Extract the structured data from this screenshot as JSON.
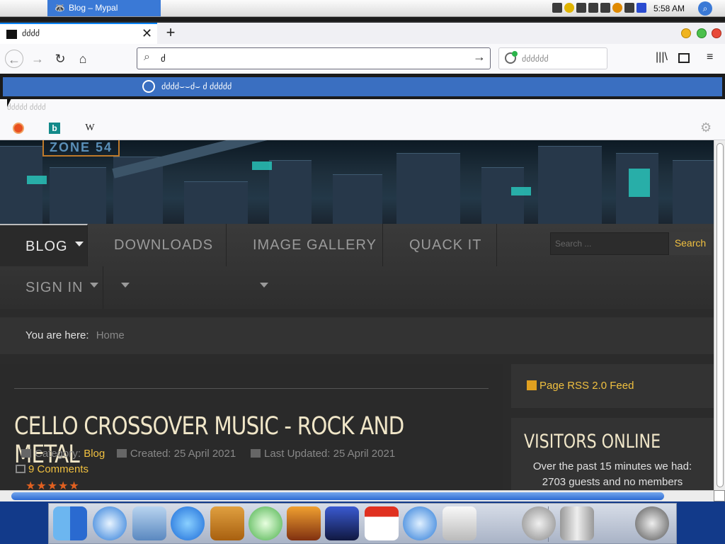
{
  "os": {
    "active_window_title": "Blog – Mypal",
    "clock": "5:58 AM"
  },
  "browser": {
    "tab_title": "ძძძძ",
    "url_value": "ძ",
    "search_placeholder": "ძძძძძძ",
    "notification": "ძძძძ⌣⌣ძ⌣ ძ ძძძძძ",
    "subnote": "ძძძძძ ძძძძ",
    "bookmarks": [
      "duckduckgo-icon",
      "bing-icon",
      "wikipedia-icon"
    ],
    "wiki_glyph": "W"
  },
  "site": {
    "logo_text": "ZONE 54",
    "menu": {
      "blog": "BLOG",
      "downloads": "DOWNLOADS",
      "gallery": "IMAGE GALLERY",
      "quack": "QUACK IT",
      "signin": "SIGN IN"
    },
    "search_placeholder": "Search ...",
    "search_button": "Search",
    "breadcrumb_label": "You are here:",
    "breadcrumb_home": "Home",
    "article": {
      "title": "CELLO CROSSOVER MUSIC - ROCK AND METAL",
      "category_label": "Category:",
      "category": "Blog",
      "created": "Created: 25 April 2021",
      "updated": "Last Updated: 25 April 2021",
      "comments": "9 Comments",
      "rating": 5
    },
    "rss": "Page RSS 2.0 Feed",
    "visitors": {
      "title": "VISITORS ONLINE",
      "line1": "Over the past 15 minutes we had:",
      "line2": "2703 guests and no members"
    }
  },
  "colors": {
    "accent": "#f0c040",
    "os_highlight": "#3a79d6",
    "notice": "#3a6fc1"
  }
}
